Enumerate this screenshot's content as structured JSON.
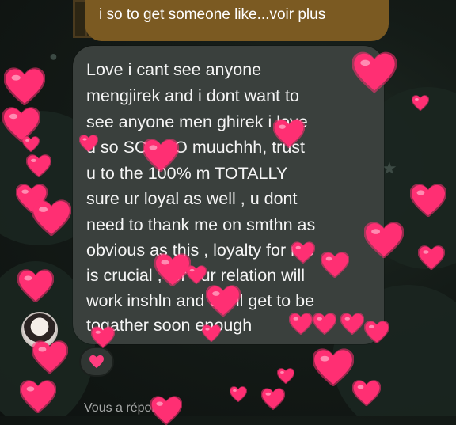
{
  "previous_message": {
    "text": "i so to get someone like...voir plus"
  },
  "message": {
    "lines": [
      "Love i cant see anyone",
      "mengjirek and i dont want to",
      "see anyone men ghirek i love",
      "u so  SOOOO muuchhh,  trust",
      "u to the 100% m TOTALLY",
      "sure ur loyal as well , u dont",
      "need to thank me on smthn as",
      "obvious as this , loyalty for me",
      "is crucial , for our relation will",
      "work inshln and we ll get to be",
      "togather soon enough"
    ]
  },
  "reaction": {
    "icon": "heart-icon",
    "color": "#ff3d7f"
  },
  "reply_status": "Vous a répondu",
  "colors": {
    "previous_bubble": "#7b5a22",
    "message_bubble": "#3a403d",
    "heart": "#ff2f73"
  }
}
